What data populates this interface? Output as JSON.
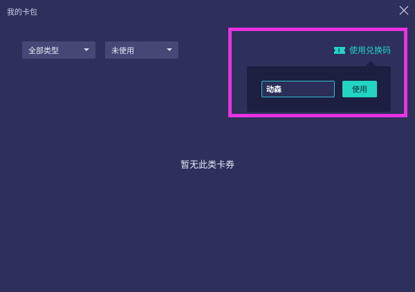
{
  "window": {
    "title": "我的卡包"
  },
  "filters": {
    "type_selected": "全部类型",
    "status_selected": "未使用"
  },
  "redeem": {
    "link_label": "使用兑换码",
    "input_value": "动森",
    "use_button_label": "使用"
  },
  "empty_state": {
    "message": "暂无此类卡券"
  },
  "colors": {
    "background": "#2e305c",
    "accent": "#20d6c2",
    "highlight": "#e834e0"
  },
  "icons": {
    "close": "close-icon",
    "chevron": "chevron-down-icon",
    "ticket": "ticket-icon"
  }
}
